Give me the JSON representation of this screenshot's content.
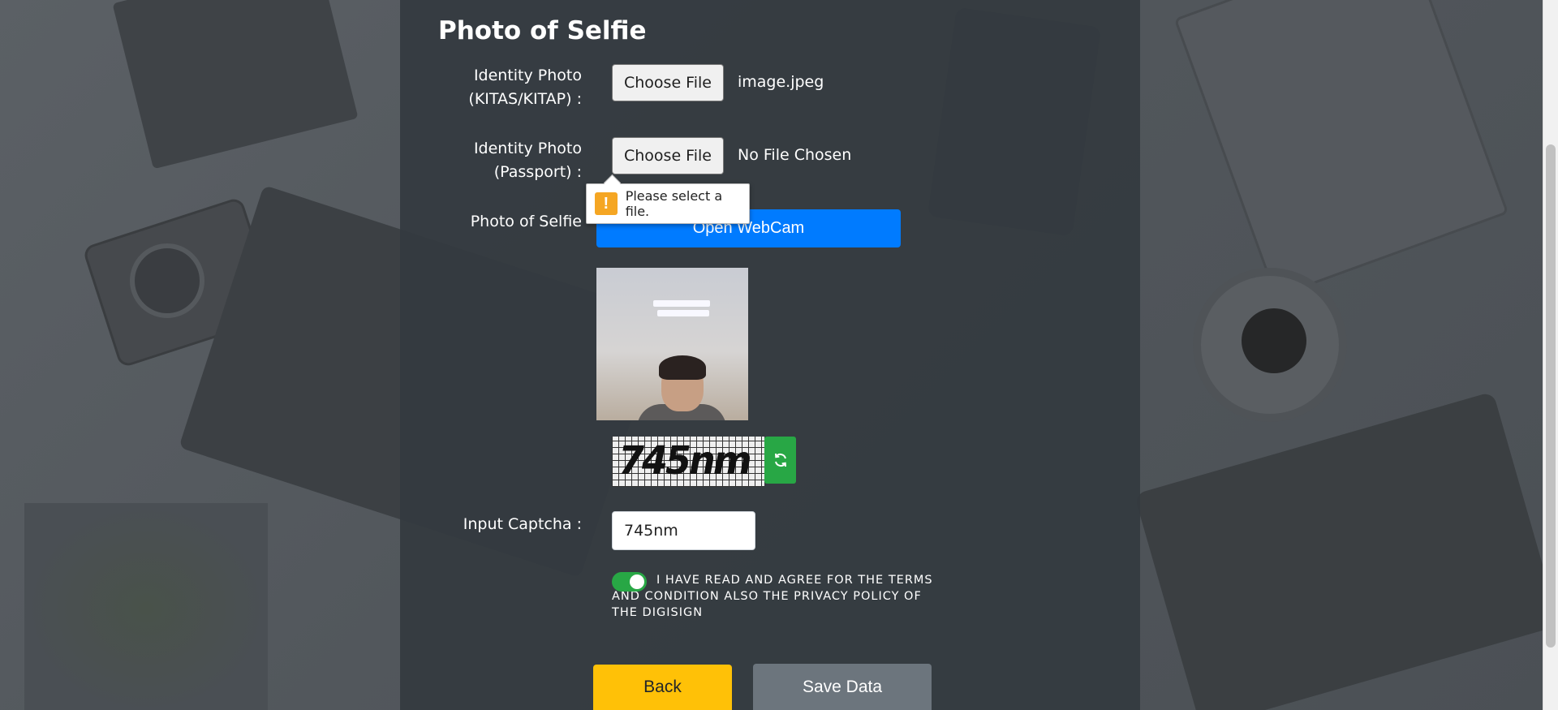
{
  "section": {
    "title": "Photo of Selfie"
  },
  "identity_kitas": {
    "label_line1": "Identity Photo",
    "label_line2": "(KITAS/KITAP) :",
    "button_label": "Choose File",
    "file_name": "image.jpeg"
  },
  "identity_passport": {
    "label_line1": "Identity Photo",
    "label_line2": "(Passport) :",
    "button_label": "Choose File",
    "file_name": "No File Chosen"
  },
  "validation_tooltip": {
    "icon": "warning-icon",
    "icon_glyph": "!",
    "text": "Please select a file."
  },
  "selfie": {
    "label": "Photo of Selfie",
    "webcam_button": "Open WebCam"
  },
  "captcha": {
    "image_text": "745nm",
    "refresh_icon": "refresh-icon",
    "input_label": "Input Captcha :",
    "input_value": "745nm"
  },
  "agreement": {
    "checked": true,
    "text": "I HAVE READ AND AGREE FOR THE TERMS AND CONDITION ALSO THE PRIVACY POLICY OF THE DIGISIGN"
  },
  "actions": {
    "back_label": "Back",
    "save_label": "Save Data"
  },
  "colors": {
    "primary": "#007bff",
    "warning": "#ffc107",
    "success": "#28a745",
    "secondary": "#6c757d",
    "panel": "#343a40"
  }
}
